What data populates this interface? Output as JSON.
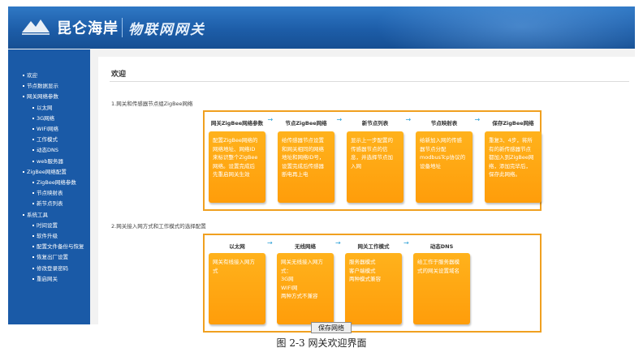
{
  "header": {
    "brand": "昆仑海岸",
    "product": "物联网网关",
    "logo_label": "KunLun"
  },
  "sidebar": {
    "items": [
      {
        "label": "欢迎",
        "level": 1
      },
      {
        "label": "节点数据显示",
        "level": 1
      },
      {
        "label": "网关网络参数",
        "level": 1
      },
      {
        "label": "以太网",
        "level": 2
      },
      {
        "label": "3G网络",
        "level": 2
      },
      {
        "label": "WIFI网络",
        "level": 2
      },
      {
        "label": "工作模式",
        "level": 2
      },
      {
        "label": "动态DNS",
        "level": 2
      },
      {
        "label": "web服务器",
        "level": 2
      },
      {
        "label": "ZigBee网络配置",
        "level": 1
      },
      {
        "label": "ZigBee网络参数",
        "level": 2
      },
      {
        "label": "节点映射表",
        "level": 2
      },
      {
        "label": "新节点列表",
        "level": 2
      },
      {
        "label": "系统工具",
        "level": 1
      },
      {
        "label": "时间设置",
        "level": 2
      },
      {
        "label": "软件升级",
        "level": 2
      },
      {
        "label": "配置文件备份与恢复",
        "level": 2
      },
      {
        "label": "恢复出厂设置",
        "level": 2
      },
      {
        "label": "修改登录密码",
        "level": 2
      },
      {
        "label": "重启网关",
        "level": 2
      }
    ]
  },
  "main": {
    "title": "欢迎",
    "section1": {
      "heading": "1.网关和传感器节点组ZigBee网络",
      "steps": [
        {
          "title": "网关ZigBee网络参数",
          "lines": [
            "配置ZigBee网络的",
            "网络地址、网络ID",
            "来标识整个ZigBee",
            "网络。设置完成后",
            "先重启网关生效"
          ]
        },
        {
          "title": "节点ZigBee网络",
          "lines": [
            "给传感器节点设置",
            "和网关相同的网络",
            "地址和网络ID号，",
            "设置完成后传感器",
            "断电再上电"
          ]
        },
        {
          "title": "新节点列表",
          "lines": [
            "显示上一步配置的",
            "传感器节点的信",
            "息，并选择节点加",
            "入网"
          ]
        },
        {
          "title": "节点映射表",
          "lines": [
            "给新加入网的传感",
            "器节点分配",
            "modbusTcp协议的",
            "设备地址"
          ]
        },
        {
          "title": "保存ZigBee网络",
          "lines": [
            "重复3、4步，将所",
            "有的新传感器节点",
            "都加入到ZigBee网",
            "络，添加完毕后，",
            "保存此网络。"
          ]
        }
      ]
    },
    "section2": {
      "heading": "2.网关接入网方式和工作模式的选择配置",
      "steps": [
        {
          "title": "以太网",
          "lines": [
            "网关有线接入网方",
            "式"
          ]
        },
        {
          "title": "无线网络",
          "lines": [
            "网关无线接入网方",
            "式：",
            "3G网",
            "WIFI网",
            "两种方式不兼容"
          ]
        },
        {
          "title": "网关工作模式",
          "lines": [
            "服务器模式",
            "客户端模式",
            "两种模式兼容"
          ]
        },
        {
          "title": "动态DNS",
          "lines": [
            "给工作于服务器模",
            "式的网关设置域名"
          ]
        }
      ]
    },
    "save_button": "保存网络"
  },
  "caption": "图 2-3 网关欢迎界面",
  "colors": {
    "banner": "#1d5da8",
    "sidebar": "#1a5aa7",
    "box_orange": "#ff9d0a",
    "panel_border": "#f0a020",
    "arrow": "#2a9fd6"
  }
}
